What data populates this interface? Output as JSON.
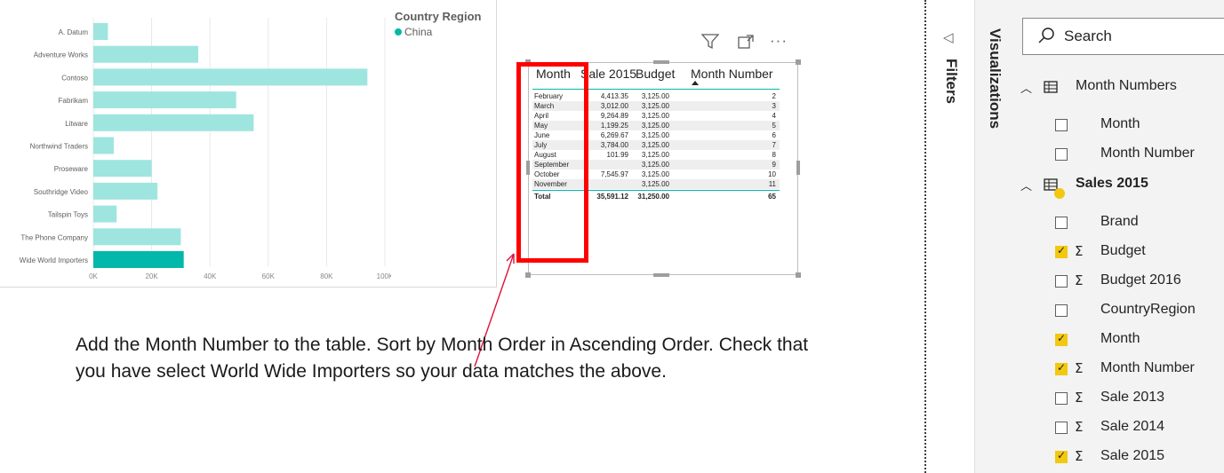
{
  "bar_chart": {
    "legend_title": "Country Region",
    "legend_item": "China",
    "colors": {
      "bar": "#9ee5df",
      "highlight": "#01b8aa"
    }
  },
  "chart_data": {
    "type": "bar",
    "orientation": "horizontal",
    "categories": [
      "A. Datum",
      "Adventure Works",
      "Contoso",
      "Fabrikam",
      "Litware",
      "Northwind Traders",
      "Proseware",
      "Southridge Video",
      "Tailspin Toys",
      "The Phone Company",
      "Wide World Importers"
    ],
    "values": [
      5000,
      36000,
      94000,
      49000,
      55000,
      7000,
      20000,
      22000,
      8000,
      30000,
      31000
    ],
    "highlighted": "Wide World Importers",
    "x_ticks": [
      "0K",
      "20K",
      "40K",
      "60K",
      "80K",
      "100K"
    ],
    "xlim": [
      0,
      100000
    ],
    "legend": {
      "title": "Country Region",
      "entries": [
        "China"
      ],
      "position": "top-right"
    },
    "grid": true
  },
  "table_visual": {
    "icons": [
      "filter-icon",
      "focus-mode-icon",
      "more-options-icon"
    ],
    "more_label": "···",
    "columns": [
      "Month",
      "Sale 2015",
      "Budget",
      "Month Number"
    ],
    "rows": [
      [
        "February",
        "4,413.35",
        "3,125.00",
        "2"
      ],
      [
        "March",
        "3,012.00",
        "3,125.00",
        "3"
      ],
      [
        "April",
        "9,264.89",
        "3,125.00",
        "4"
      ],
      [
        "May",
        "1,199.25",
        "3,125.00",
        "5"
      ],
      [
        "June",
        "6,269.67",
        "3,125.00",
        "6"
      ],
      [
        "July",
        "3,784.00",
        "3,125.00",
        "7"
      ],
      [
        "August",
        "101.99",
        "3,125.00",
        "8"
      ],
      [
        "September",
        "",
        "3,125.00",
        "9"
      ],
      [
        "October",
        "7,545.97",
        "3,125.00",
        "10"
      ],
      [
        "November",
        "",
        "3,125.00",
        "11"
      ]
    ],
    "total": [
      "Total",
      "35,591.12",
      "31,250.00",
      "65"
    ],
    "sort_column": "Month Number",
    "sort_direction": "ascending"
  },
  "instruction": "Add the Month Number to the table. Sort by Month Order in Ascending Order. Check that you have select World Wide Importers so your data matches the above.",
  "panes": {
    "filters_label": "Filters",
    "visualizations_label": "Visualizations",
    "search_placeholder": "Search"
  },
  "fields": {
    "tables": [
      {
        "name": "Month Numbers",
        "expanded": true,
        "fields": [
          {
            "name": "Month",
            "checked": false,
            "sigma": false
          },
          {
            "name": "Month Number",
            "checked": false,
            "sigma": false
          }
        ]
      },
      {
        "name": "Sales 2015",
        "expanded": true,
        "fields": [
          {
            "name": "Brand",
            "checked": false,
            "sigma": false
          },
          {
            "name": "Budget",
            "checked": true,
            "sigma": true
          },
          {
            "name": "Budget 2016",
            "checked": false,
            "sigma": true
          },
          {
            "name": "CountryRegion",
            "checked": false,
            "sigma": false
          },
          {
            "name": "Month",
            "checked": true,
            "sigma": false
          },
          {
            "name": "Month Number",
            "checked": true,
            "sigma": true
          },
          {
            "name": "Sale 2013",
            "checked": false,
            "sigma": true
          },
          {
            "name": "Sale 2014",
            "checked": false,
            "sigma": true
          },
          {
            "name": "Sale 2015",
            "checked": true,
            "sigma": true
          }
        ]
      }
    ]
  }
}
